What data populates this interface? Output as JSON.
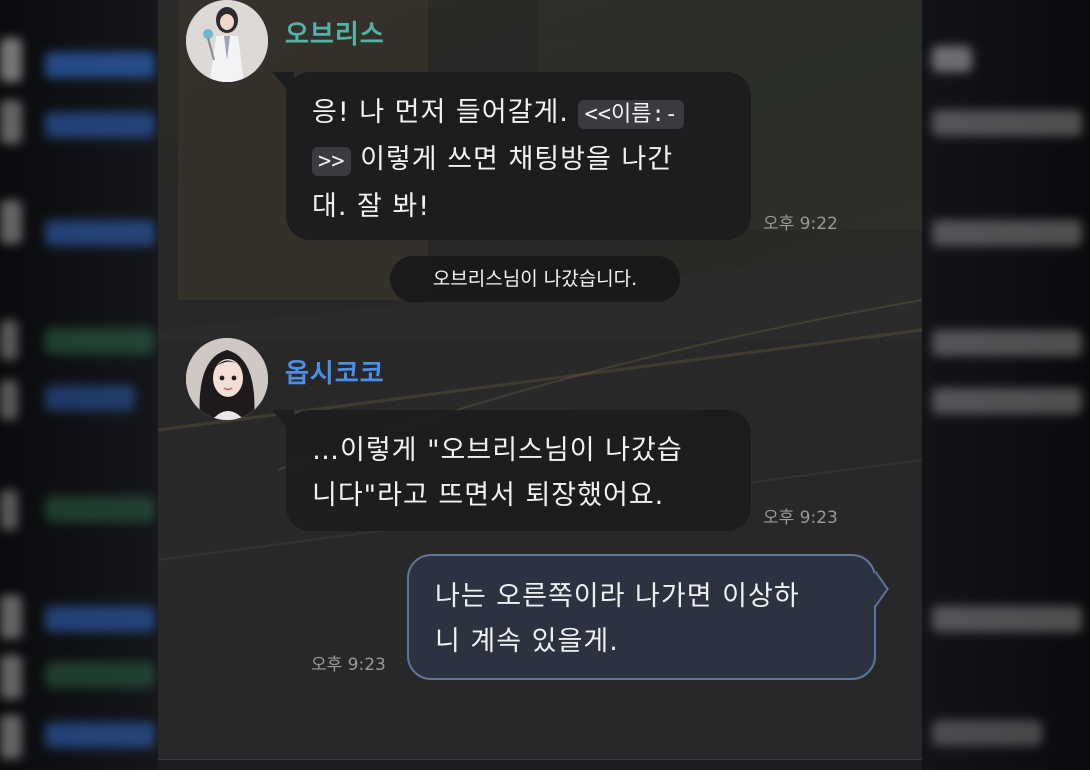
{
  "colors": {
    "accent_teal": "#53b3a6",
    "accent_blue": "#4b8fe8",
    "user_bubble_bg": "#2b3341",
    "user_bubble_border": "#5f7598"
  },
  "messages": [
    {
      "sender": "오브리스",
      "avatar_icon": "character-avatar-white-coat",
      "line1": "응! 나 먼저 들어갈게.",
      "code1": "<<이름:-",
      "code2": ">>",
      "line2": "이렇게 쓰면 채팅방을 나간",
      "line3": "대. 잘 봐!",
      "time": "오후 9:22"
    },
    {
      "system": "오브리스님이 나갔습니다."
    },
    {
      "sender": "옵시코코",
      "avatar_icon": "character-avatar-dark-hair",
      "line1": "…이렇게 \"오브리스님이 나갔습",
      "line2": "니다\"라고 뜨면서 퇴장했어요.",
      "time": "오후 9:23"
    },
    {
      "sender": "me",
      "line1": "나는 오른쪽이라 나가면 이상하",
      "line2": "니 계속 있을게.",
      "time": "오후 9:23"
    }
  ]
}
